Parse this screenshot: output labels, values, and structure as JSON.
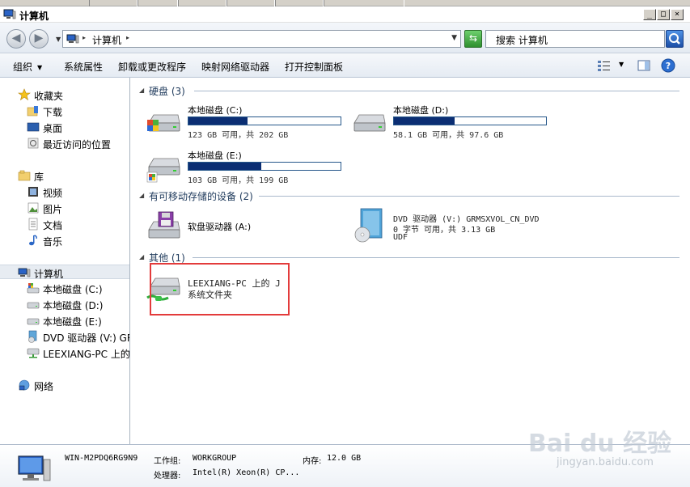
{
  "window": {
    "title": "计算机"
  },
  "address": {
    "crumb": "计算机"
  },
  "search": {
    "placeholder": "搜索 计算机"
  },
  "commands": [
    {
      "label": "组织",
      "dropdown": true
    },
    {
      "label": "系统属性"
    },
    {
      "label": "卸载或更改程序"
    },
    {
      "label": "映射网络驱动器"
    },
    {
      "label": "打开控制面板"
    }
  ],
  "sidebar": {
    "favorites": {
      "label": "收藏夹",
      "items": [
        "下载",
        "桌面",
        "最近访问的位置"
      ]
    },
    "libraries": {
      "label": "库",
      "items": [
        "视频",
        "图片",
        "文档",
        "音乐"
      ]
    },
    "computer": {
      "label": "计算机",
      "items": [
        "本地磁盘 (C:)",
        "本地磁盘 (D:)",
        "本地磁盘 (E:)",
        "DVD 驱动器 (V:) GR",
        "LEEXIANG-PC 上的 J"
      ]
    },
    "network": {
      "label": "网络"
    }
  },
  "groups": {
    "hdd": {
      "label": "硬盘 (3)"
    },
    "removable": {
      "label": "有可移动存储的设备 (2)"
    },
    "other": {
      "label": "其他 (1)"
    }
  },
  "drives": [
    {
      "name": "本地磁盘 (C:)",
      "info": "123 GB 可用，共 202 GB",
      "used_fraction": 0.39
    },
    {
      "name": "本地磁盘 (D:)",
      "info": "58.1 GB 可用，共 97.6 GB",
      "used_fraction": 0.4
    },
    {
      "name": "本地磁盘 (E:)",
      "info": "103 GB 可用，共 199 GB",
      "used_fraction": 0.48
    }
  ],
  "removable": {
    "floppy": {
      "name": "软盘驱动器 (A:)"
    },
    "dvd": {
      "name": "DVD 驱动器 (V:) GRMSXVOL_CN_DVD",
      "line2": "0 字节 可用，共 3.13 GB",
      "line3": "UDF"
    }
  },
  "other": {
    "share": {
      "name": "LEEXIANG-PC 上的 J",
      "type": "系统文件夹"
    }
  },
  "details": {
    "computer_name": "WIN-M2PDQ6RG9N9",
    "workgroup_label": "工作组:",
    "workgroup": "WORKGROUP",
    "memory_label": "内存:",
    "memory": "12.0 GB",
    "cpu_label": "处理器:",
    "cpu": "Intel(R) Xeon(R) CP..."
  },
  "watermark": {
    "main": "Bai du 经验",
    "sub": "jingyan.baidu.com"
  }
}
